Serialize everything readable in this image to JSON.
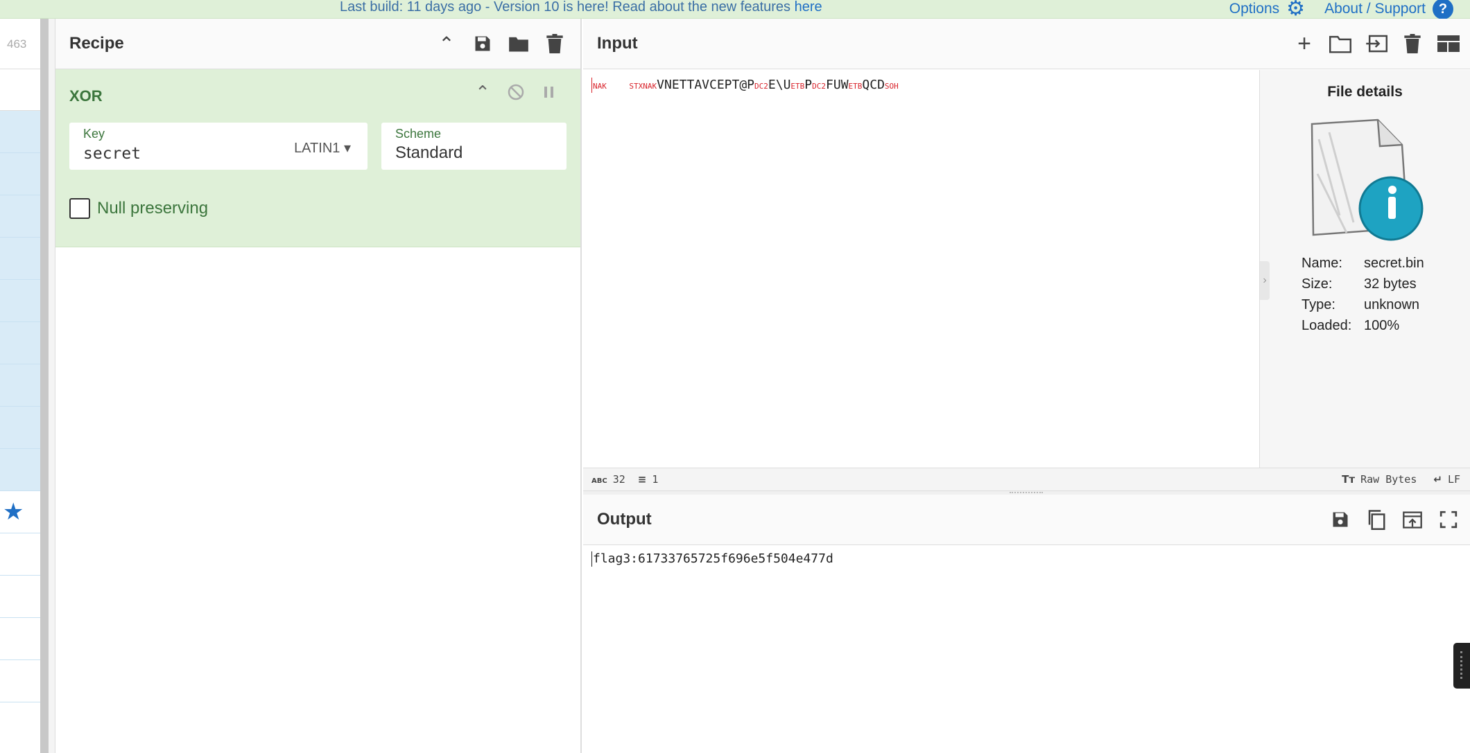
{
  "banner": {
    "text": "Last build: 11 days ago - Version 10 is here! Read about the new features ",
    "link": "here",
    "options_label": "Options",
    "about_label": "About / Support",
    "help_glyph": "?"
  },
  "operations": {
    "count": "463",
    "favourite_icon": "star-icon"
  },
  "recipe": {
    "title": "Recipe",
    "operation": {
      "name": "XOR",
      "key_label": "Key",
      "key_value": "secret",
      "key_encoding": "LATIN1",
      "scheme_label": "Scheme",
      "scheme_value": "Standard",
      "null_preserving_label": "Null preserving",
      "null_preserving_checked": false
    }
  },
  "input": {
    "title": "Input",
    "segments": [
      {
        "t": "NAK",
        "cc": true
      },
      {
        "t": "   ",
        "cc": false
      },
      {
        "t": "STX",
        "cc": true
      },
      {
        "t": "NAK",
        "cc": true
      },
      {
        "t": "VNETTAVCEPT@P",
        "cc": false
      },
      {
        "t": "DC2",
        "cc": true
      },
      {
        "t": "E\\U",
        "cc": false
      },
      {
        "t": "ETB",
        "cc": true
      },
      {
        "t": "P",
        "cc": false
      },
      {
        "t": "DC2",
        "cc": true
      },
      {
        "t": "FUW",
        "cc": false
      },
      {
        "t": "ETB",
        "cc": true
      },
      {
        "t": "QCD",
        "cc": false
      },
      {
        "t": "SOH",
        "cc": true
      }
    ],
    "file_details": {
      "title": "File details",
      "name_key": "Name:",
      "name_value": "secret.bin",
      "size_key": "Size:",
      "size_value": "32 bytes",
      "type_key": "Type:",
      "type_value": "unknown",
      "loaded_key": "Loaded:",
      "loaded_value": "100%"
    },
    "status": {
      "length_label": "ABC",
      "length": "32",
      "lines": "1",
      "encoding_label": "Raw Bytes",
      "eol_label": "LF"
    }
  },
  "output": {
    "title": "Output",
    "text": "flag3:61733765725f696e5f504e477d"
  }
}
